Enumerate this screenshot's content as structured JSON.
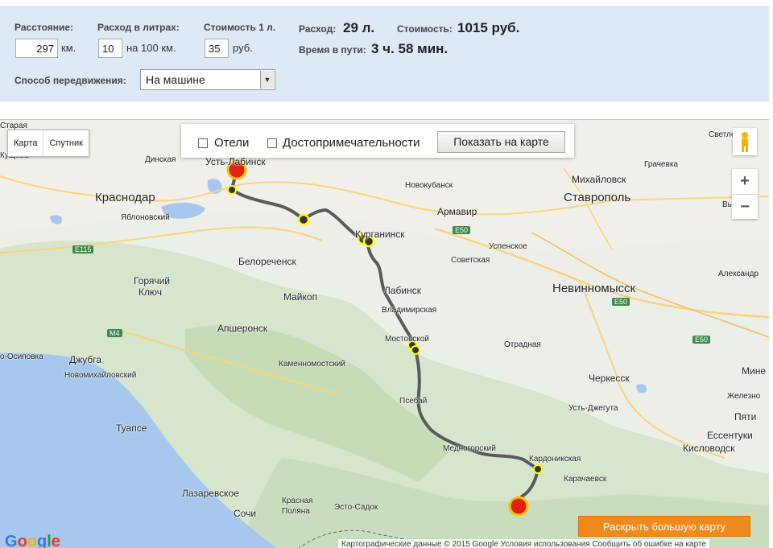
{
  "calc": {
    "distance_label": "Расстояние:",
    "distance_value": "297",
    "distance_unit": "км.",
    "fuel_label": "Расход в литрах:",
    "fuel_value": "10",
    "fuel_unit": "на 100 км.",
    "price_label": "Стоимость 1 л.",
    "price_value": "35",
    "price_unit": "руб.",
    "consumption_label": "Расход:",
    "consumption_value": "29 л.",
    "cost_label": "Стоимость:",
    "cost_value": "1015 руб.",
    "time_label": "Время в пути:",
    "time_value": "3 ч. 58 мин.",
    "mode_label": "Способ передвижения:",
    "mode_value": "На машине"
  },
  "map": {
    "type_map": "Карта",
    "type_satellite": "Спутник",
    "hotels_label": "Отели",
    "sights_label": "Достопримечательности",
    "show_button": "Показать на карте",
    "zoom_in": "+",
    "zoom_out": "−",
    "google_logo": "Google",
    "attribution": "Картографические данные © 2015 Google    Условия использования    Сообщить об ошибке на карте",
    "expand_button": "Раскрыть большую карту",
    "cities": {
      "krasnodar": "Краснодар",
      "ust_labinsk": "Усть-Лабинск",
      "dinskaya": "Динская",
      "staraya": "Старая",
      "kusheva": "Кущева",
      "yablonovsky": "Яблоновский",
      "novokubansk": "Новокубанск",
      "armavir": "Армавир",
      "kurganinsk": "Курганинск",
      "uspenskoe": "Успенское",
      "sovetskaya": "Советская",
      "mikhaylovsk": "Михайловск",
      "stavropol": "Ставрополь",
      "grachevka": "Грачевка",
      "svetlograd": "Светлог",
      "belorechensk": "Белореченск",
      "goryachy_klyuch_1": "Горячий",
      "goryachy_klyuch_2": "Ключ",
      "maykop": "Майкоп",
      "labinsk": "Лабинск",
      "vladimirskaya": "Владимирская",
      "nevinnomyssk": "Невинномысск",
      "aleksandr": "Александр",
      "apsheronsk": "Апшеронск",
      "mostovskoy": "Мостовской",
      "dzhubga": "Джубга",
      "novomikhaylovsky": "Новомихайловский",
      "osipovka": "о-Осиповка",
      "kamennomostsky": "Каменномостский",
      "otradnaya": "Отрадная",
      "cherkessk": "Черкесск",
      "mine": "Мине",
      "zhelezno": "Железно",
      "tuapse": "Туапсе",
      "psebay": "Псебай",
      "ust_dzheguta": "Усть-Джегута",
      "pyati": "Пяти",
      "essentuki": "Ессентуки",
      "kislovodsk": "Кисловодск",
      "mednogorsky": "Медногорский",
      "kardonikskaya": "Кардоникская",
      "karachaevsk": "Карачаевск",
      "lazarevskoe": "Лазаревское",
      "sochi": "Сочи",
      "krasnaya_polyana_1": "Красная",
      "krasnaya_polyana_2": "Поляна",
      "esto_sadok": "Эсто-Садок",
      "m4": "M4",
      "e115": "E115",
      "e50a": "E50",
      "e50b": "E50",
      "e50c": "E50",
      "vyshe": "Выше"
    }
  },
  "colors": {
    "panel_bg": "#dde9f4",
    "route": "#5a5a5a",
    "sea": "#a7c7ee",
    "forest": "#cfe2c3",
    "expand_bg": "#f08a1c"
  }
}
